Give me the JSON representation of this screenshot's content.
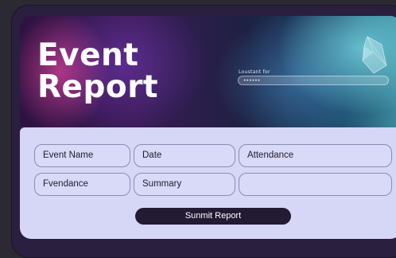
{
  "hero": {
    "title_line1": "Event",
    "title_line2": "Report",
    "input_label": "Loustant for",
    "input_value": "••••••"
  },
  "form": {
    "fields": [
      {
        "label": "Event Name"
      },
      {
        "label": "Date"
      },
      {
        "label": "Attendance"
      },
      {
        "label": "Fvendance"
      },
      {
        "label": "Summary"
      },
      {
        "label": ""
      }
    ],
    "submit_label": "Sunmit Report"
  },
  "colors": {
    "panel": "#d6d7f7",
    "button": "#231a33",
    "field_border": "#8a8cb4"
  }
}
